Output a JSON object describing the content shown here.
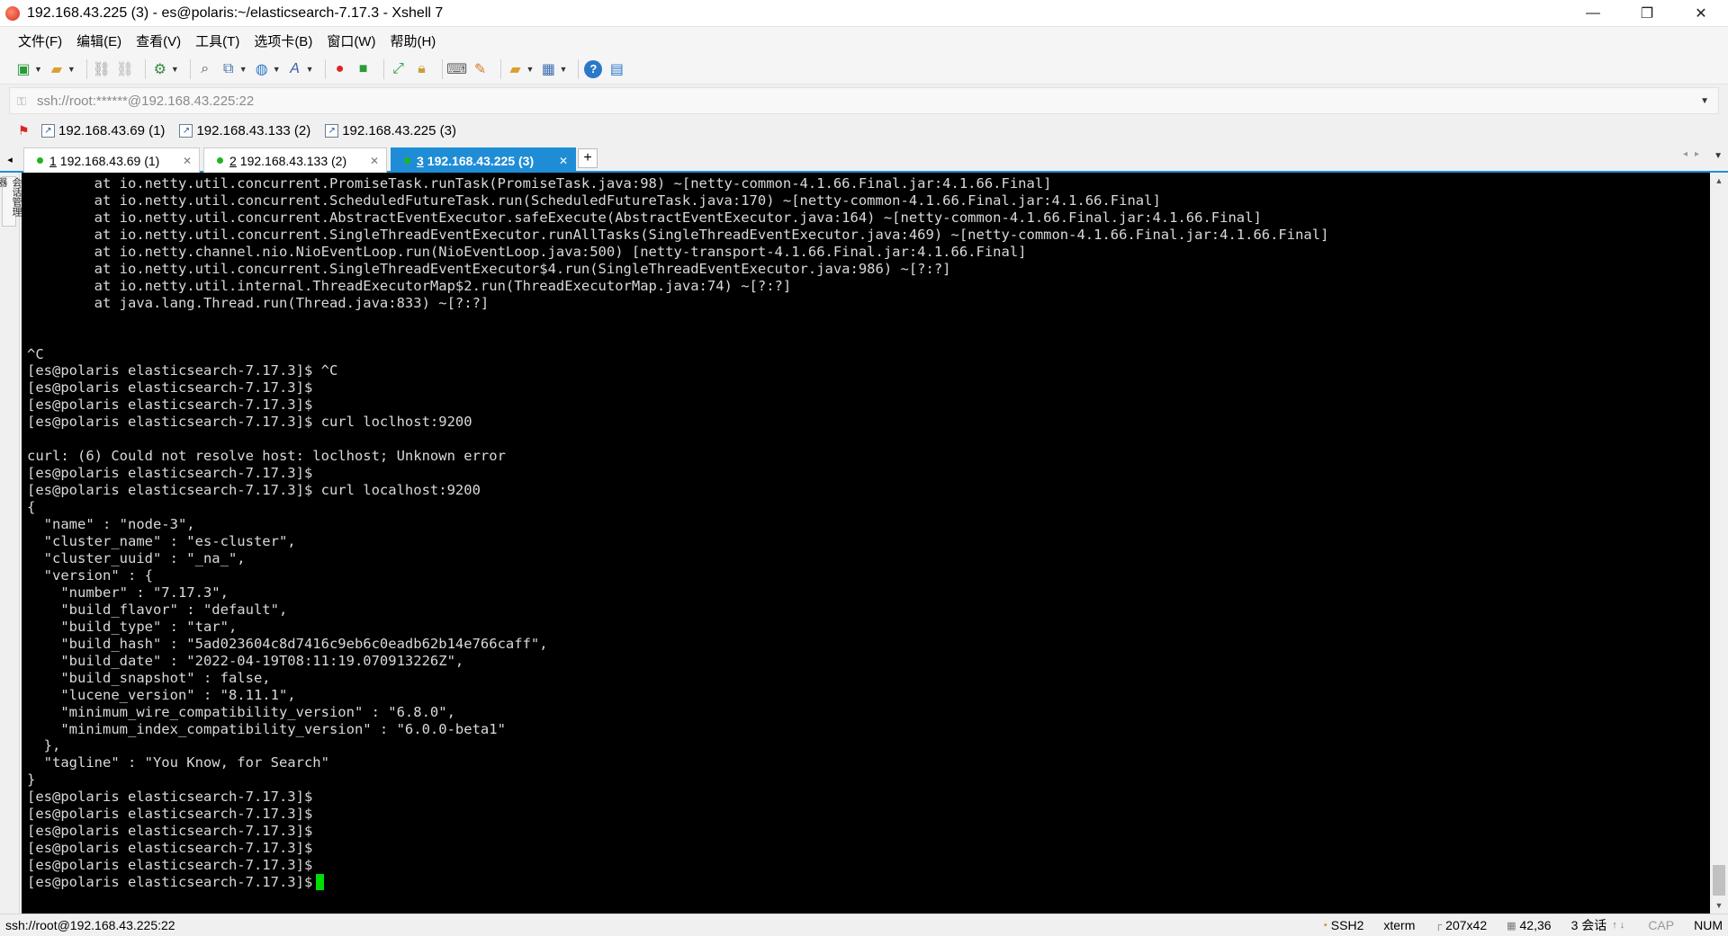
{
  "window": {
    "title": "192.168.43.225 (3) - es@polaris:~/elasticsearch-7.17.3 - Xshell 7",
    "minimize": "—",
    "restore": "❐",
    "close": "✕"
  },
  "menu": [
    "文件(F)",
    "编辑(E)",
    "查看(V)",
    "工具(T)",
    "选项卡(B)",
    "窗口(W)",
    "帮助(H)"
  ],
  "toolbar": {
    "icons": [
      "new-session-icon",
      "open-folder-icon",
      "connect-icon",
      "disconnect-icon",
      "properties-icon",
      "find-icon",
      "copy-icon",
      "globe-icon",
      "font-icon",
      "xftp-icon",
      "xmanager-icon",
      "fullscreen-icon",
      "lock-icon",
      "keyboard-icon",
      "highlight-icon",
      "compose-icon",
      "layout-icon",
      "help-icon",
      "chat-icon"
    ]
  },
  "address": {
    "value": "ssh://root:******@192.168.43.225:22"
  },
  "quick_sessions": [
    {
      "label": "192.168.43.69 (1)"
    },
    {
      "label": "192.168.43.133 (2)"
    },
    {
      "label": "192.168.43.225 (3)"
    }
  ],
  "tabs": [
    {
      "num": "1",
      "label": "192.168.43.69 (1)"
    },
    {
      "num": "2",
      "label": "192.168.43.133 (2)"
    },
    {
      "num": "3",
      "label": "192.168.43.225 (3)"
    }
  ],
  "side_panel": {
    "label": "会话管理器"
  },
  "terminal": {
    "lines": [
      "        at io.netty.util.concurrent.PromiseTask.runTask(PromiseTask.java:98) ~[netty-common-4.1.66.Final.jar:4.1.66.Final]",
      "        at io.netty.util.concurrent.ScheduledFutureTask.run(ScheduledFutureTask.java:170) ~[netty-common-4.1.66.Final.jar:4.1.66.Final]",
      "        at io.netty.util.concurrent.AbstractEventExecutor.safeExecute(AbstractEventExecutor.java:164) ~[netty-common-4.1.66.Final.jar:4.1.66.Final]",
      "        at io.netty.util.concurrent.SingleThreadEventExecutor.runAllTasks(SingleThreadEventExecutor.java:469) ~[netty-common-4.1.66.Final.jar:4.1.66.Final]",
      "        at io.netty.channel.nio.NioEventLoop.run(NioEventLoop.java:500) [netty-transport-4.1.66.Final.jar:4.1.66.Final]",
      "        at io.netty.util.concurrent.SingleThreadEventExecutor$4.run(SingleThreadEventExecutor.java:986) ~[?:?]",
      "        at io.netty.util.internal.ThreadExecutorMap$2.run(ThreadExecutorMap.java:74) ~[?:?]",
      "        at java.lang.Thread.run(Thread.java:833) ~[?:?]",
      "",
      "",
      "^C",
      "[es@polaris elasticsearch-7.17.3]$ ^C",
      "[es@polaris elasticsearch-7.17.3]$",
      "[es@polaris elasticsearch-7.17.3]$",
      "[es@polaris elasticsearch-7.17.3]$ curl loclhost:9200",
      "",
      "curl: (6) Could not resolve host: loclhost; Unknown error",
      "[es@polaris elasticsearch-7.17.3]$",
      "[es@polaris elasticsearch-7.17.3]$ curl localhost:9200",
      "{",
      "  \"name\" : \"node-3\",",
      "  \"cluster_name\" : \"es-cluster\",",
      "  \"cluster_uuid\" : \"_na_\",",
      "  \"version\" : {",
      "    \"number\" : \"7.17.3\",",
      "    \"build_flavor\" : \"default\",",
      "    \"build_type\" : \"tar\",",
      "    \"build_hash\" : \"5ad023604c8d7416c9eb6c0eadb62b14e766caff\",",
      "    \"build_date\" : \"2022-04-19T08:11:19.070913226Z\",",
      "    \"build_snapshot\" : false,",
      "    \"lucene_version\" : \"8.11.1\",",
      "    \"minimum_wire_compatibility_version\" : \"6.8.0\",",
      "    \"minimum_index_compatibility_version\" : \"6.0.0-beta1\"",
      "  },",
      "  \"tagline\" : \"You Know, for Search\"",
      "}",
      "[es@polaris elasticsearch-7.17.3]$",
      "[es@polaris elasticsearch-7.17.3]$",
      "[es@polaris elasticsearch-7.17.3]$",
      "[es@polaris elasticsearch-7.17.3]$",
      "[es@polaris elasticsearch-7.17.3]$"
    ],
    "prompt_line": "[es@polaris elasticsearch-7.17.3]$"
  },
  "status": {
    "connection": "ssh://root@192.168.43.225:22",
    "protocol": "SSH2",
    "term": "xterm",
    "size": "207x42",
    "position": "42,36",
    "sessions": "3 会话",
    "cap": "CAP",
    "num": "NUM"
  }
}
